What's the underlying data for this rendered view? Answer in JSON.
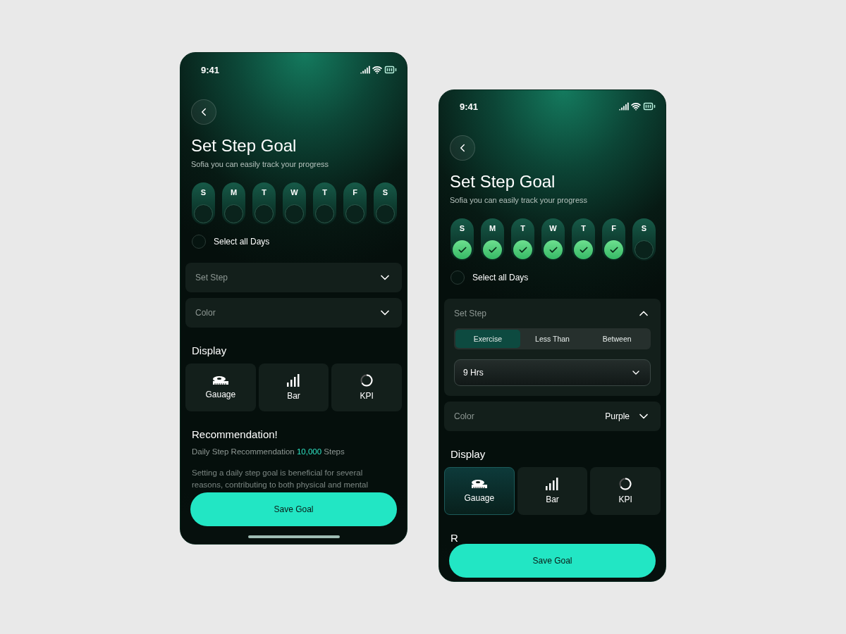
{
  "screens": [
    {
      "status_time": "9:41",
      "title": "Set Step Goal",
      "subtitle": "Sofia you can easily track your progress",
      "days": [
        {
          "label": "S",
          "checked": false
        },
        {
          "label": "M",
          "checked": false
        },
        {
          "label": "T",
          "checked": false
        },
        {
          "label": "W",
          "checked": false
        },
        {
          "label": "T",
          "checked": false
        },
        {
          "label": "F",
          "checked": false
        },
        {
          "label": "S",
          "checked": false
        }
      ],
      "select_all": {
        "label": "Select all Days",
        "checked": false
      },
      "set_step": {
        "label": "Set Step",
        "expanded": false
      },
      "color": {
        "label": "Color",
        "expanded": false
      },
      "display": {
        "title": "Display",
        "options": [
          {
            "label": "Gauage",
            "kind": "gauge",
            "selected": false
          },
          {
            "label": "Bar",
            "kind": "bar",
            "selected": false
          },
          {
            "label": "KPI",
            "kind": "kpi",
            "selected": false
          }
        ]
      },
      "recommendation": {
        "title": "Recommendation!",
        "prefix": "Daily Step Recommendation",
        "highlight": "10,000",
        "suffix": "Steps",
        "paragraph": "Setting a daily step goal is beneficial for several reasons, contributing to both physical and mental"
      },
      "save_button": "Save Goal"
    },
    {
      "status_time": "9:41",
      "title": "Set Step Goal",
      "subtitle": "Sofia you can easily track your progress",
      "days": [
        {
          "label": "S",
          "checked": true
        },
        {
          "label": "M",
          "checked": true
        },
        {
          "label": "T",
          "checked": true
        },
        {
          "label": "W",
          "checked": true
        },
        {
          "label": "T",
          "checked": true
        },
        {
          "label": "F",
          "checked": true
        },
        {
          "label": "S",
          "checked": false
        }
      ],
      "select_all": {
        "label": "Select all Days",
        "checked": false
      },
      "set_step": {
        "label": "Set Step",
        "expanded": true,
        "modes": [
          {
            "label": "Exercise",
            "selected": true
          },
          {
            "label": "Less Than",
            "selected": false
          },
          {
            "label": "Between",
            "selected": false
          }
        ],
        "value": "9 Hrs"
      },
      "color": {
        "label": "Color",
        "value": "Purple",
        "expanded": false
      },
      "display": {
        "title": "Display",
        "options": [
          {
            "label": "Gauage",
            "kind": "gauge",
            "selected": true
          },
          {
            "label": "Bar",
            "kind": "bar",
            "selected": false
          },
          {
            "label": "KPI",
            "kind": "kpi",
            "selected": false
          }
        ]
      },
      "recommendation": {
        "title": "R"
      },
      "save_button": "Save Goal"
    }
  ]
}
